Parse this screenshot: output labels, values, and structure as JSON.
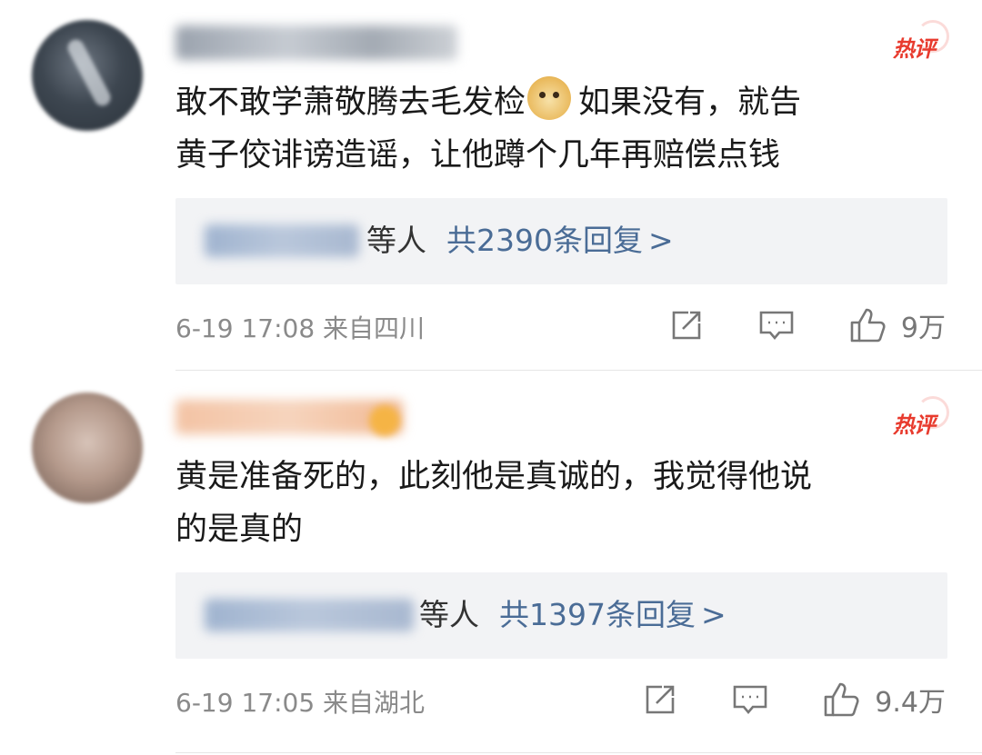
{
  "comments": [
    {
      "badge": "热评",
      "text_lines": [
        "敢不敢学萧敬腾去毛发检",
        "如果没有，就告",
        "黄子佼诽谤造谣，让他蹲个几年再赔偿点钱"
      ],
      "emoji_icon": "doge-emoji",
      "reply_suffix": "等人",
      "reply_count": "共2390条回复",
      "reply_arrow": ">",
      "meta": "6-19 17:08 来自四川",
      "likes": "9万"
    },
    {
      "badge": "热评",
      "text_lines": [
        "黄是准备死的，此刻他是真诚的，我觉得他说",
        "的是真的"
      ],
      "reply_suffix": "等人",
      "reply_count": "共1397条回复",
      "reply_arrow": ">",
      "meta": "6-19 17:05 来自湖北",
      "likes": "9.4万"
    }
  ],
  "colors": {
    "hot_badge": "#e83b2e",
    "link": "#4a6c96",
    "muted": "#8a8a8a",
    "reply_bg": "#f2f3f5"
  },
  "icons": [
    "share-icon",
    "comment-icon",
    "like-icon"
  ]
}
